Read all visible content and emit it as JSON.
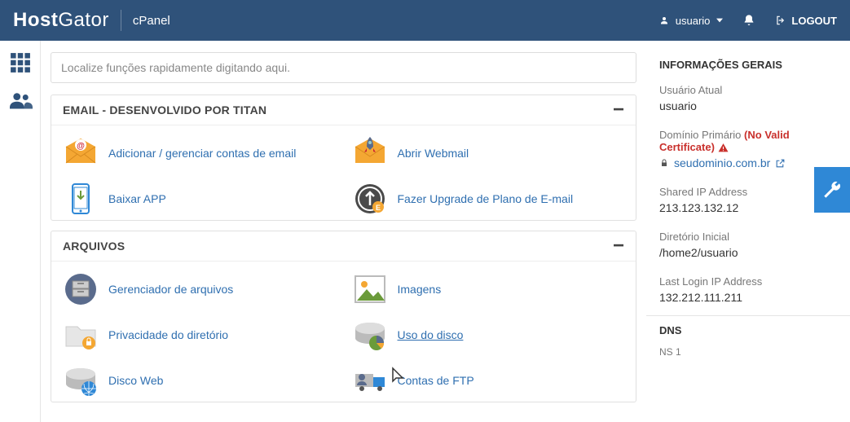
{
  "header": {
    "brand_bold": "Host",
    "brand_thin": "Gator",
    "product": "cPanel",
    "username": "usuario",
    "logout": "LOGOUT"
  },
  "search": {
    "placeholder": "Localize funções rapidamente digitando aqui."
  },
  "panels": {
    "email": {
      "title": "EMAIL - DESENVOLVIDO POR TITAN",
      "items": {
        "manage": "Adicionar / gerenciar contas de email",
        "webmail": "Abrir Webmail",
        "download": "Baixar APP",
        "upgrade": "Fazer Upgrade de Plano de E-mail"
      }
    },
    "files": {
      "title": "ARQUIVOS",
      "items": {
        "filemgr": "Gerenciador de arquivos",
        "images": "Imagens",
        "dirprivacy": "Privacidade do diretório",
        "diskusage": "Uso do disco",
        "webdisk": "Disco Web",
        "ftp": "Contas de FTP"
      }
    }
  },
  "sidebar": {
    "title": "INFORMAÇÕES GERAIS",
    "current_user_label": "Usuário Atual",
    "current_user": "usuario",
    "primary_domain_label": "Domínio Primário",
    "no_valid_cert": "(No Valid Certificate)",
    "domain": "seudominio.com.br",
    "shared_ip_label": "Shared IP Address",
    "shared_ip": "213.123.132.12",
    "home_label": "Diretório Inicial",
    "home": "/home2/usuario",
    "last_login_label": "Last Login IP Address",
    "last_login": "132.212.111.211",
    "dns_title": "DNS",
    "ns1": "NS 1"
  }
}
